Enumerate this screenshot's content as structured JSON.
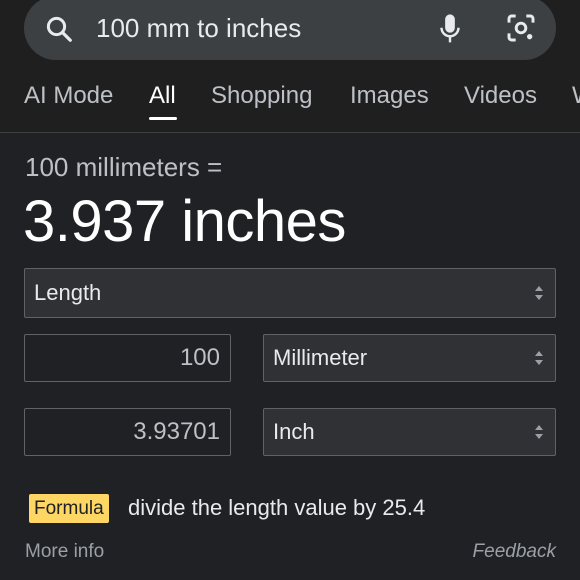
{
  "search": {
    "query": "100 mm to inches",
    "icons": {
      "search": "search-icon",
      "voice": "mic-icon",
      "lens": "lens-icon"
    }
  },
  "tabs": [
    {
      "label": "AI Mode"
    },
    {
      "label": "All",
      "active": true
    },
    {
      "label": "Shopping"
    },
    {
      "label": "Images"
    },
    {
      "label": "Videos"
    },
    {
      "label": "W"
    }
  ],
  "converter": {
    "equation": "100 millimeters =",
    "result": "3.937 inches",
    "unit_type": "Length",
    "from": {
      "value": "100",
      "unit": "Millimeter"
    },
    "to": {
      "value": "3.93701",
      "unit": "Inch"
    },
    "formula_label": "Formula",
    "formula_text": "divide the length value by 25.4",
    "more_info": "More info",
    "feedback": "Feedback"
  },
  "colors": {
    "background": "#202124",
    "accent_badge": "#fdd663"
  }
}
